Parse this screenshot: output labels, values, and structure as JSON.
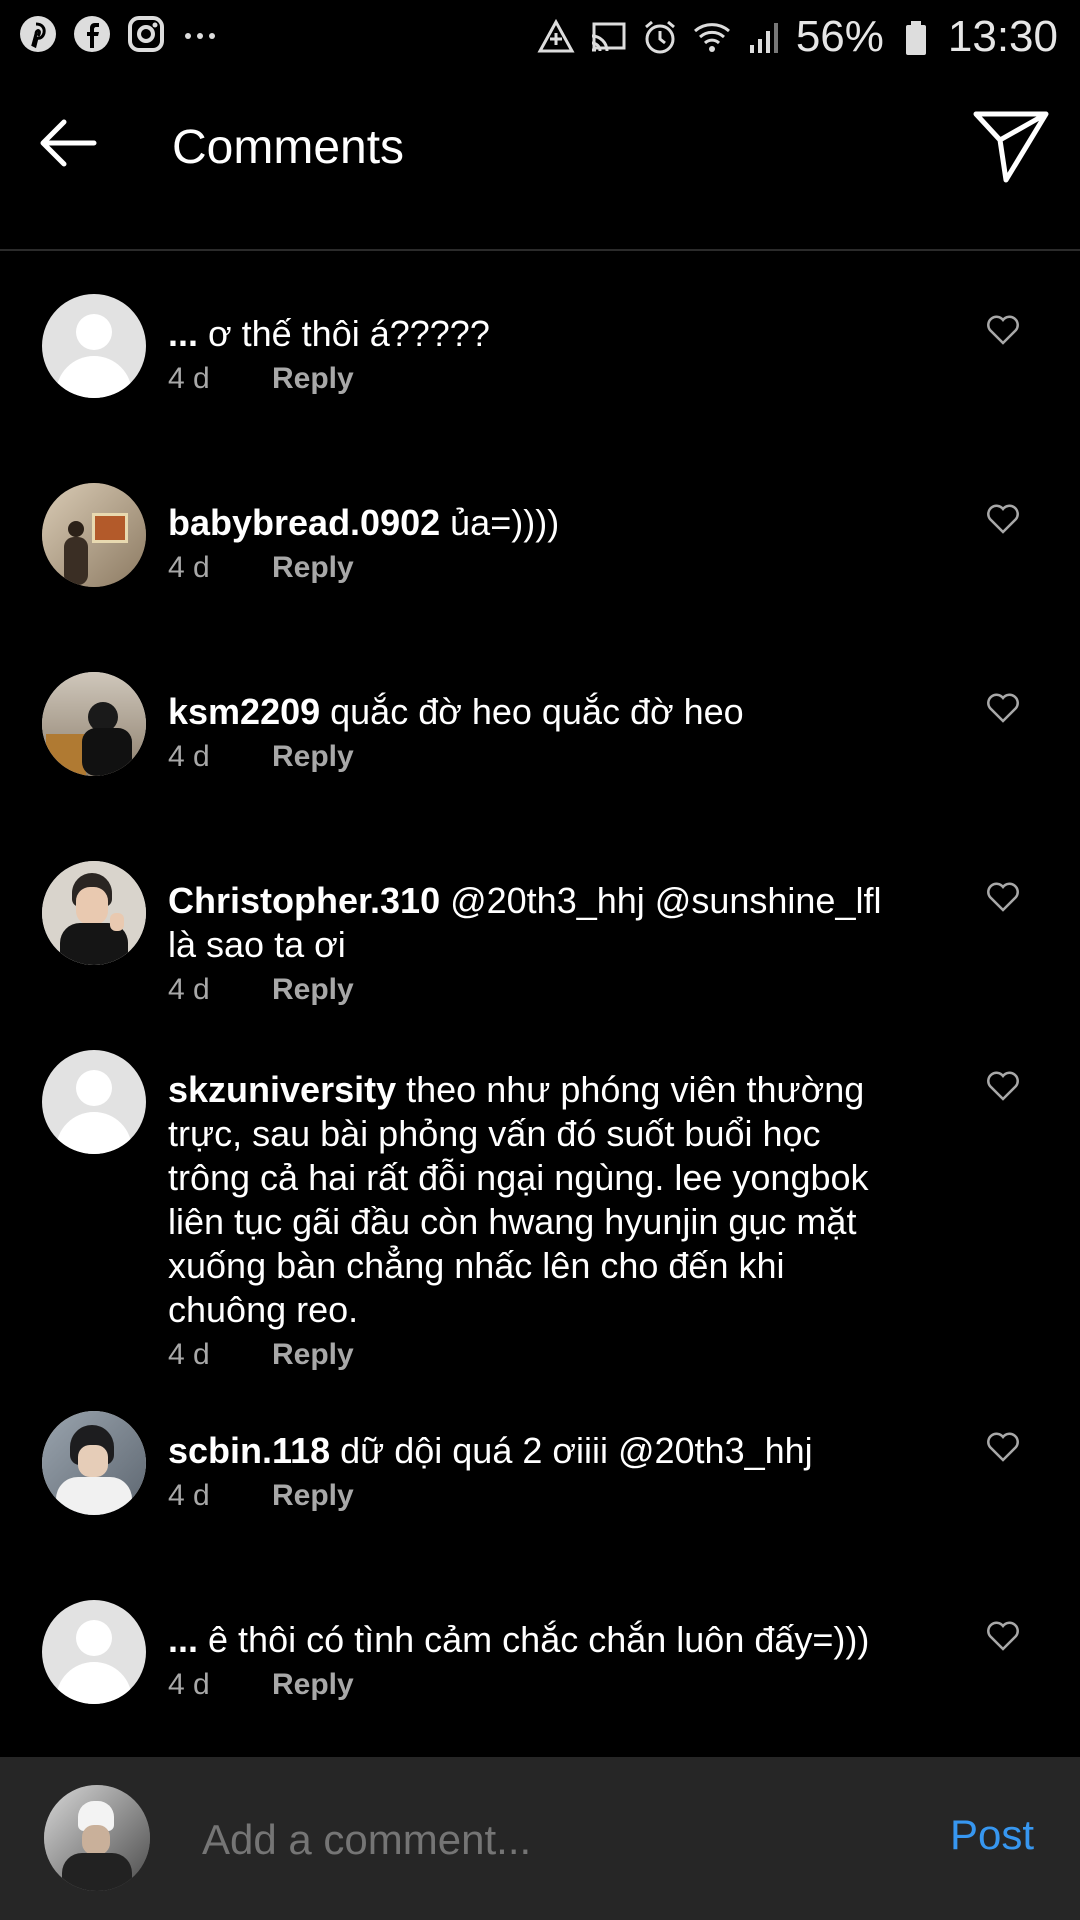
{
  "status_bar": {
    "battery": "56%",
    "time": "13:30",
    "left_icons": [
      "pinterest-icon",
      "facebook-icon",
      "instagram-icon",
      "more-dots-icon"
    ],
    "right_icons": [
      "data-saver-icon",
      "cast-icon",
      "alarm-icon",
      "wifi-icon",
      "signal-icon",
      "battery-icon"
    ]
  },
  "header": {
    "title": "Comments",
    "back_icon": "arrow-left-icon",
    "share_icon": "send-icon"
  },
  "comments": [
    {
      "user": "...",
      "text": " ơ thế thôi á?????",
      "time": "4 d",
      "reply": "Reply",
      "avatar": "default"
    },
    {
      "user": "babybread.0902",
      "text": " ủa=))))",
      "time": "4 d",
      "reply": "Reply",
      "avatar": "photo"
    },
    {
      "user": "ksm2209",
      "text": " quắc đờ heo quắc đờ heo",
      "time": "4 d",
      "reply": "Reply",
      "avatar": "photo"
    },
    {
      "user": "Christopher.310",
      "text": " @20th3_hhj @sunshine_lfl là sao ta ơi",
      "time": "4 d",
      "reply": "Reply",
      "avatar": "photo"
    },
    {
      "user": "skzuniversity",
      "text": " theo như phóng viên thường trực, sau bài phỏng vấn đó suốt buổi học trông cả hai rất đỗi ngại ngùng. lee yongbok liên tục gãi đầu còn hwang hyunjin gục mặt xuống bàn chẳng nhấc lên cho đến khi chuông reo.",
      "time": "4 d",
      "reply": "Reply",
      "avatar": "default"
    },
    {
      "user": "scbin.118",
      "text": " dữ dội quá 2 ơiiii @20th3_hhj",
      "time": "4 d",
      "reply": "Reply",
      "avatar": "photo"
    },
    {
      "user": "...",
      "text": " ê thôi có tình cảm chắc chắn luôn đấy=)))",
      "time": "4 d",
      "reply": "Reply",
      "avatar": "default"
    }
  ],
  "composer": {
    "placeholder": "Add a comment...",
    "post_label": "Post",
    "accent_color": "#3797f0"
  }
}
